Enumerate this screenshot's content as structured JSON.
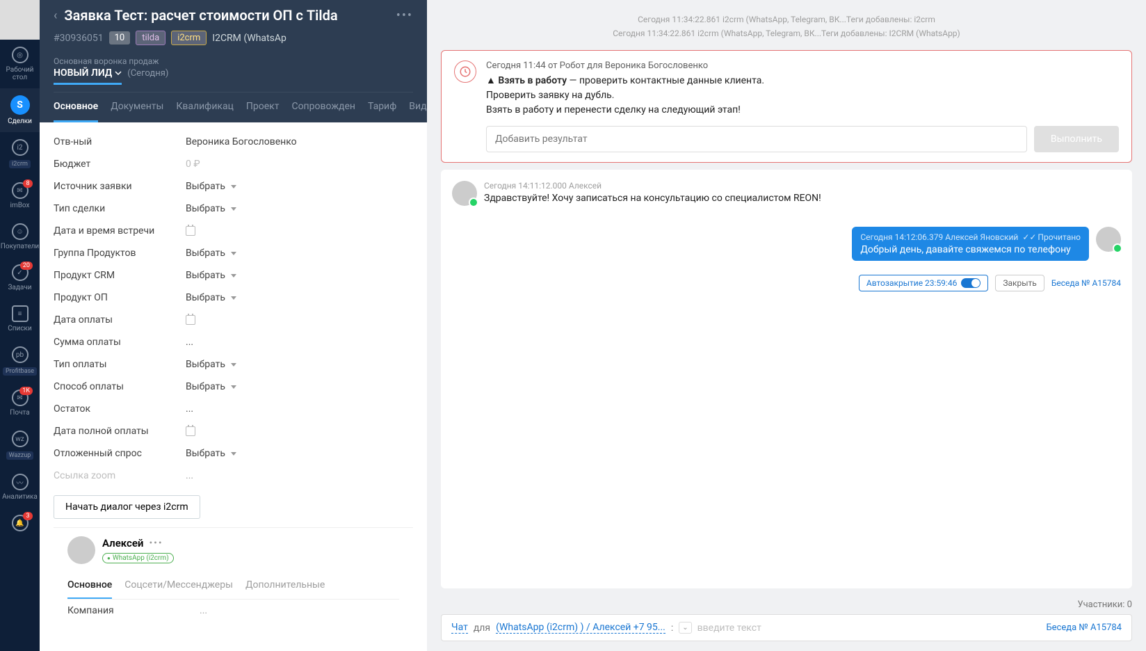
{
  "sidebar": {
    "items": [
      {
        "label": "Рабочий стол",
        "icon": "desktop"
      },
      {
        "label": "Сделки",
        "icon": "deals",
        "active": true
      },
      {
        "label": "i2crm",
        "icon": "i2crm",
        "pill": true
      },
      {
        "label": "imBox",
        "icon": "imbox",
        "badge": "8"
      },
      {
        "label": "Покупатели",
        "icon": "buyers"
      },
      {
        "label": "Задачи",
        "icon": "tasks",
        "badge": "20"
      },
      {
        "label": "Списки",
        "icon": "lists"
      },
      {
        "label": "Profitbase",
        "icon": "pb",
        "pill": true
      },
      {
        "label": "Почта",
        "icon": "mail",
        "badge": "1K"
      },
      {
        "label": "Wazzup",
        "icon": "wz",
        "pill": true
      },
      {
        "label": "Аналитика",
        "icon": "analytics"
      },
      {
        "label": "",
        "icon": "bell",
        "badge": "3"
      }
    ]
  },
  "header": {
    "title": "Заявка Тест: расчет стоимости ОП с Tilda",
    "deal_id": "#30936051",
    "score": "10",
    "tag1": "tilda",
    "tag2": "i2crm",
    "integration": "I2CRM (WhatsAp",
    "pipeline": "Основная воронка продаж",
    "stage": "НОВЫЙ ЛИД",
    "stage_date": "(Сегодня)"
  },
  "tabs": [
    "Основное",
    "Документы",
    "Квалификац",
    "Проект",
    "Сопровожден",
    "Тариф",
    "Виджеты"
  ],
  "fields": [
    {
      "label": "Отв-ный",
      "value": "Вероника Богословенко",
      "type": "text"
    },
    {
      "label": "Бюджет",
      "value": "0 ₽",
      "type": "ruble"
    },
    {
      "label": "Источник заявки",
      "value": "Выбрать",
      "type": "select"
    },
    {
      "label": "Тип сделки",
      "value": "Выбрать",
      "type": "select"
    },
    {
      "label": "Дата и время встречи",
      "value": "",
      "type": "date"
    },
    {
      "label": "Группа Продуктов",
      "value": "Выбрать",
      "type": "select"
    },
    {
      "label": "Продукт CRM",
      "value": "Выбрать",
      "type": "select"
    },
    {
      "label": "Продукт ОП",
      "value": "Выбрать",
      "type": "select"
    },
    {
      "label": "Дата оплаты",
      "value": "",
      "type": "date"
    },
    {
      "label": "Сумма оплаты",
      "value": "...",
      "type": "dots"
    },
    {
      "label": "Тип оплаты",
      "value": "Выбрать",
      "type": "select"
    },
    {
      "label": "Способ оплаты",
      "value": "Выбрать",
      "type": "select"
    },
    {
      "label": "Остаток",
      "value": "...",
      "type": "dots"
    },
    {
      "label": "Дата полной оплаты",
      "value": "",
      "type": "date"
    },
    {
      "label": "Отложенный спрос",
      "value": "Выбрать",
      "type": "select"
    },
    {
      "label": "Ссылка zoom",
      "value": "...",
      "type": "dots-gray"
    }
  ],
  "dialog_btn": "Начать диалог через i2crm",
  "contact": {
    "name": "Алексей",
    "badge": "WhatsApp (i2crm)",
    "tabs": [
      "Основное",
      "Соцсети/Мессенджеры",
      "Дополнительные"
    ],
    "company_label": "Компания",
    "company_value": "..."
  },
  "breadcrumbs": [
    "Сегодня 11:34:22.861 i2crm (WhatsApp, Telegram, ВК...Теги добавлены: i2crm",
    "Сегодня 11:34:22.861 i2crm (WhatsApp, Telegram, ВК...Теги добавлены: I2CRM (WhatsApp)"
  ],
  "task": {
    "meta": "Сегодня 11:44 от Робот для Вероника Богословенко",
    "title": "Взять в работу",
    "text1": " — проверить контактные данные клиента.",
    "text2": "Проверить заявку на дубль.",
    "text3": "Взять в работу и перенести сделку на следующий этап!",
    "placeholder": "Добавить результат",
    "button": "Выполнить"
  },
  "chat": {
    "msg_in_meta": "Сегодня 14:11:12.000 Алексей",
    "msg_in_text": "Здравствуйте! Хочу записаться на консультацию со специалистом REON!",
    "msg_out_meta": "Сегодня 14:12:06.379 Алексей Яновский",
    "msg_out_read": "Прочитано",
    "msg_out_text": "Добрый день, давайте свяжемся по телефону",
    "autoclose": "Автозакрытие 23:59:46",
    "close": "Закрыть",
    "convo": "Беседа № A15784"
  },
  "participants": "Участники: 0",
  "input_bar": {
    "chat": "Чат",
    "for": "для",
    "channel": "(WhatsApp (i2crm) ) / Алексей +7 95...",
    "colon": ":",
    "placeholder": "введите текст",
    "convo": "Беседа № A15784"
  }
}
